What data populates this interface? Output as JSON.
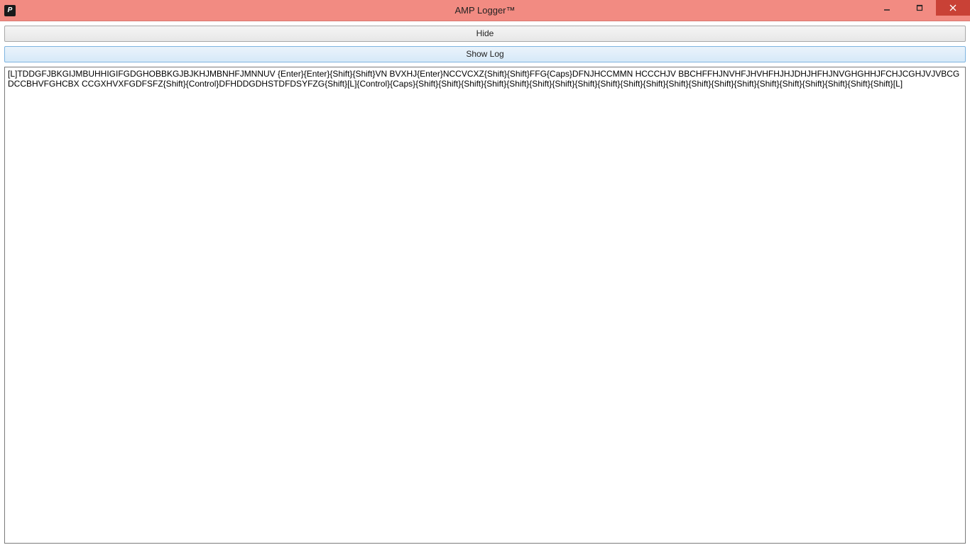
{
  "window": {
    "title": "AMP Logger™",
    "app_icon_glyph": "P"
  },
  "buttons": {
    "hide_label": "Hide",
    "show_log_label": "Show Log"
  },
  "log": {
    "text": "[L]TDDGFJBKGIJMBUHHIGIFGDGHOBBKGJBJKHJMBNHFJMNNUV {Enter}{Enter}{Shift}{Shift}VN BVXHJ{Enter}NCCVCXZ{Shift}{Shift}FFG{Caps}DFNJHCCMMN  HCCCHJV  BBCHFFHJNVHFJHVHFHJHJDHJHFHJNVGHGHHJFCHJCGHJVJVBCGDCCBHVFGHCBX CCGXHVXFGDFSFZ{Shift}{Control}DFHDDGDHSTDFDSYFZG{Shift}[L]{Control}{Caps}{Shift}{Shift}{Shift}{Shift}{Shift}{Shift}{Shift}{Shift}{Shift}{Shift}{Shift}{Shift}{Shift}{Shift}{Shift}{Shift}{Shift}{Shift}{Shift}{Shift}{Shift}[L]"
  }
}
